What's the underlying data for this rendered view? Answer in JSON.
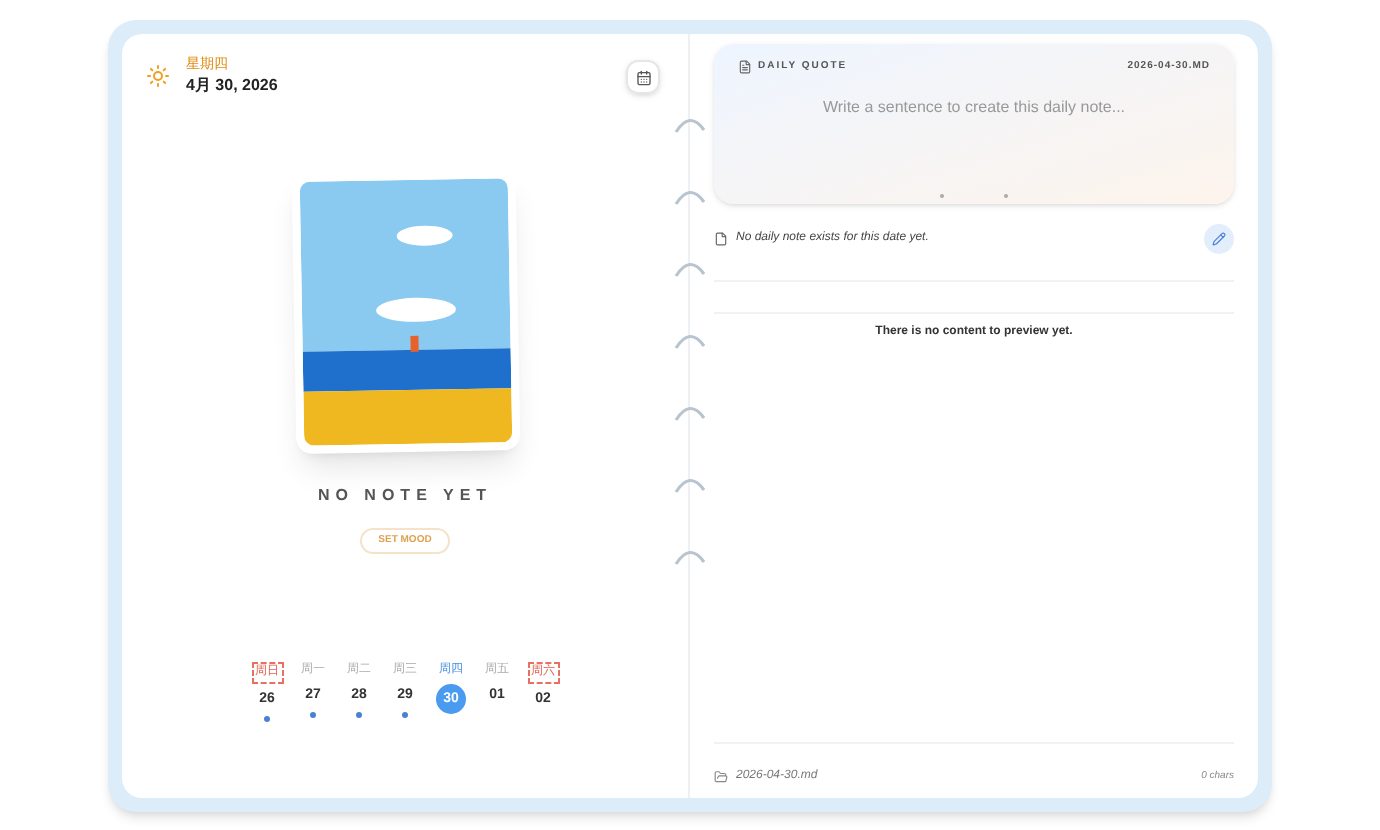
{
  "header": {
    "weekday": "星期四",
    "date": "4月 30, 2026"
  },
  "mood": {
    "title": "NO NOTE YET",
    "button": "SET MOOD"
  },
  "week": [
    {
      "label": "周日",
      "day": "26",
      "selected": false,
      "weekend": true,
      "has_entry": true
    },
    {
      "label": "周一",
      "day": "27",
      "selected": false,
      "weekend": false,
      "has_entry": true
    },
    {
      "label": "周二",
      "day": "28",
      "selected": false,
      "weekend": false,
      "has_entry": true
    },
    {
      "label": "周三",
      "day": "29",
      "selected": false,
      "weekend": false,
      "has_entry": true
    },
    {
      "label": "周四",
      "day": "30",
      "selected": true,
      "weekend": false,
      "has_entry": false
    },
    {
      "label": "周五",
      "day": "01",
      "selected": false,
      "weekend": false,
      "has_entry": false
    },
    {
      "label": "周六",
      "day": "02",
      "selected": false,
      "weekend": true,
      "has_entry": false
    }
  ],
  "quote": {
    "title": "DAILY QUOTE",
    "filename": "2026-04-30.MD",
    "placeholder": "Write a sentence to create this daily note..."
  },
  "note": {
    "status": "No daily note exists for this date yet.",
    "preview": "There is no content to preview yet."
  },
  "footer": {
    "file": "2026-04-30.md",
    "count": "0 chars"
  }
}
